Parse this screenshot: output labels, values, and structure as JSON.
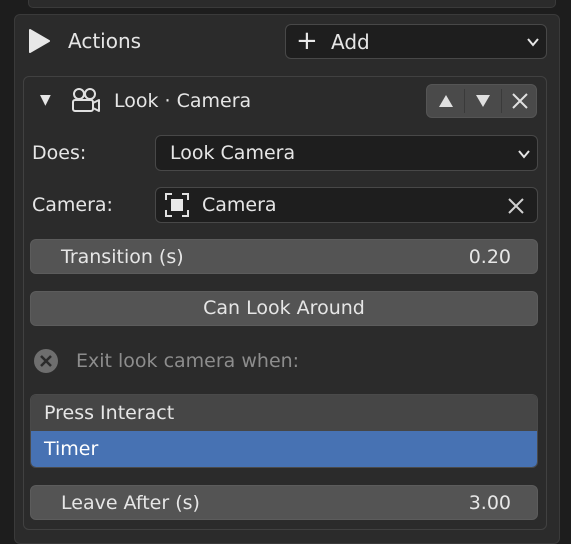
{
  "actions": {
    "title": "Actions",
    "add_label": "Add"
  },
  "action_item": {
    "title": "Look · Camera",
    "does_label": "Does:",
    "does_value": "Look Camera",
    "camera_label": "Camera:",
    "camera_value": "Camera",
    "transition_label": "Transition (s)",
    "transition_value": "0.20",
    "can_look_around_label": "Can Look Around",
    "exit_label": "Exit look camera when:",
    "exit_options": [
      "Press Interact",
      "Timer"
    ],
    "exit_selected": "Timer",
    "leave_after_label": "Leave After (s)",
    "leave_after_value": "3.00"
  },
  "colors": {
    "selected": "#4772b3",
    "panel": "#2b2b2b",
    "field": "#1e1e1e",
    "slider": "#545454"
  }
}
